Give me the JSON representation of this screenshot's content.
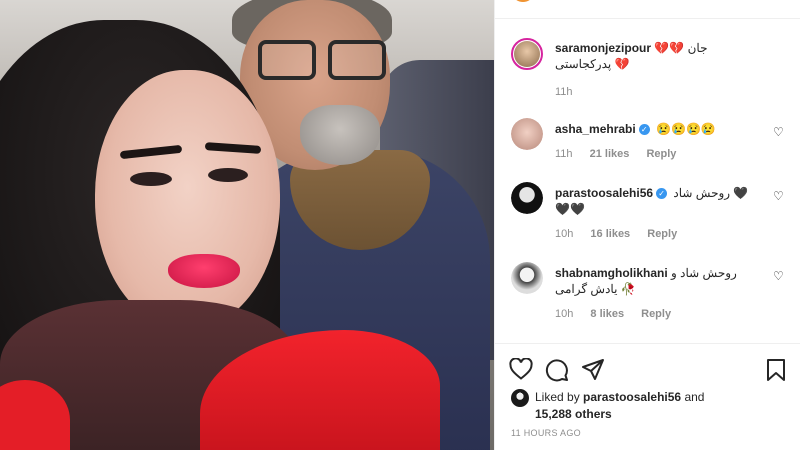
{
  "post": {
    "author": "saramonjezipour",
    "caption": "💔💔 جان پدرکجاستی 💔",
    "caption_time": "11h"
  },
  "comments": [
    {
      "user": "asha_mehrabi",
      "verified": true,
      "text": "😢😢😢😢",
      "time": "11h",
      "likes": "21 likes",
      "reply": "Reply"
    },
    {
      "user": "parastoosalehi56",
      "verified": true,
      "text": "روحش شاد 🖤🖤🖤",
      "time": "10h",
      "likes": "16 likes",
      "reply": "Reply"
    },
    {
      "user": "shabnamgholikhani",
      "verified": false,
      "text": "روحش شاد و یادش گرامی 🥀",
      "time": "10h",
      "likes": "8 likes",
      "reply": "Reply"
    }
  ],
  "likes": {
    "prefix": "Liked by",
    "user": "parastoosalehi56",
    "and": "and",
    "others": "15,288 others"
  },
  "timestamp": "11 HOURS AGO",
  "icons": {
    "like": "heart-icon",
    "comment": "comment-icon",
    "share": "share-icon",
    "save": "bookmark-icon",
    "comment_like": "heart-outline-icon",
    "verified": "verified-badge-icon"
  },
  "colors": {
    "verified": "#3897f0",
    "story_ring": "#d6249f",
    "muted_text": "#8e8e8e"
  }
}
